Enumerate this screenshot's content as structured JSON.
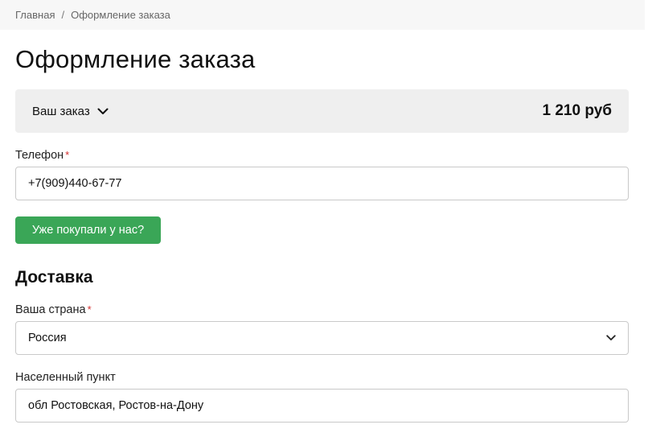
{
  "breadcrumb": {
    "home": "Главная",
    "separator": "/",
    "current": "Оформление заказа"
  },
  "page": {
    "title": "Оформление заказа"
  },
  "order_summary": {
    "label": "Ваш заказ",
    "total": "1 210 руб"
  },
  "phone": {
    "label": "Телефон",
    "required_mark": "*",
    "value": "+7(909)440-67-77"
  },
  "returning_button": {
    "label": "Уже покупали у нас?"
  },
  "delivery": {
    "title": "Доставка",
    "country": {
      "label": "Ваша страна",
      "required_mark": "*",
      "selected": "Россия"
    },
    "locality": {
      "label": "Населенный пункт",
      "value": "обл Ростовская, Ростов-на-Дону"
    }
  },
  "colors": {
    "accent_green": "#3aa657",
    "required_red": "#d32f2f",
    "summary_bg": "#efefef",
    "breadcrumb_bg": "#f7f7f7"
  },
  "icons": {
    "order_toggle": "chevron-down-icon",
    "country_select": "chevron-down-icon"
  }
}
